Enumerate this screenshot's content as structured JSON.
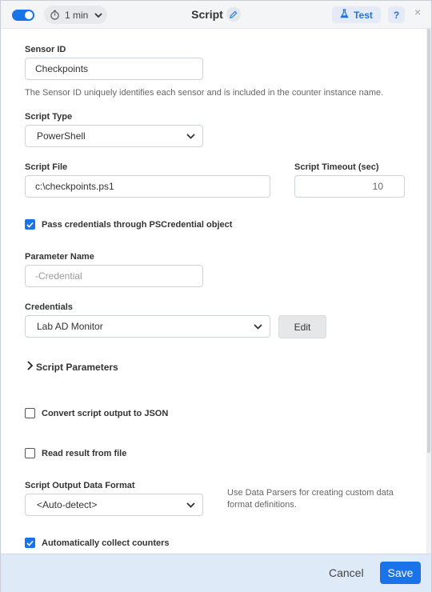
{
  "header": {
    "enabled": true,
    "interval": "1 min",
    "title": "Script",
    "test_label": "Test",
    "help_label": "?",
    "close_label": "×"
  },
  "form": {
    "sensor_id": {
      "label": "Sensor ID",
      "value": "Checkpoints",
      "hint": "The Sensor ID uniquely identifies each sensor and is included in the counter instance name."
    },
    "script_type": {
      "label": "Script Type",
      "value": "PowerShell"
    },
    "script_file": {
      "label": "Script File",
      "value": "c:\\checkpoints.ps1"
    },
    "script_timeout": {
      "label": "Script Timeout (sec)",
      "value": "10"
    },
    "pass_credentials": {
      "label": "Pass credentials through PSCredential object",
      "checked": true
    },
    "parameter_name": {
      "label": "Parameter Name",
      "placeholder": "-Credential"
    },
    "credentials": {
      "label": "Credentials",
      "value": "Lab AD Monitor",
      "edit_label": "Edit"
    },
    "script_parameters": {
      "label": "Script Parameters",
      "expanded": false
    },
    "convert_json": {
      "label": "Convert script output to JSON",
      "checked": false
    },
    "read_from_file": {
      "label": "Read result from file",
      "checked": false
    },
    "output_format": {
      "label": "Script Output Data Format",
      "value": "<Auto-detect>",
      "hint": "Use Data Parsers for creating custom data format definitions."
    },
    "auto_collect": {
      "label": "Automatically collect counters",
      "checked": true
    }
  },
  "footer": {
    "cancel_label": "Cancel",
    "save_label": "Save"
  },
  "colors": {
    "accent": "#1a73e8",
    "footer_bg": "#dfeaf8",
    "header_bg": "#f4f5f7"
  }
}
